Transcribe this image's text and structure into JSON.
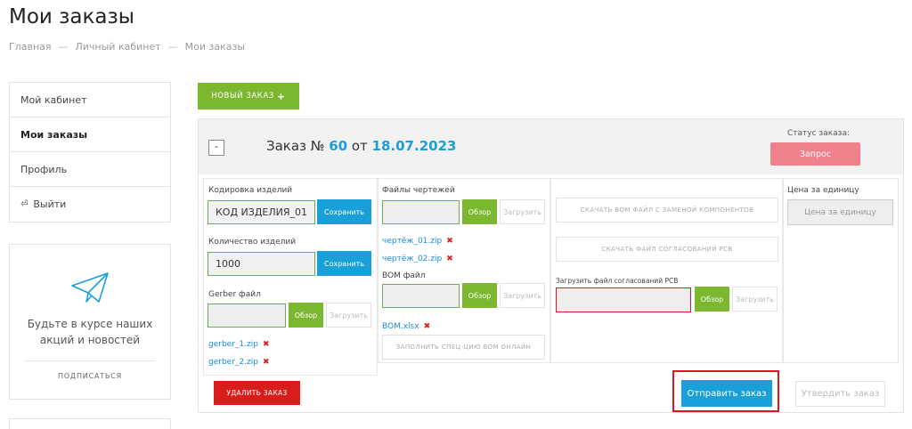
{
  "page": {
    "title": "Мои заказы",
    "breadcrumb": [
      "Главная",
      "Личный кабинет",
      "Мои заказы"
    ],
    "breadcrumb_sep": "—"
  },
  "sidebar": {
    "items": [
      {
        "label": "Мой кабинет"
      },
      {
        "label": "Мои заказы"
      },
      {
        "label": "Профиль"
      },
      {
        "label": "Выйти"
      }
    ],
    "promo_text_1": "Будьте в курсе наших",
    "promo_text_2": "акций и новостей",
    "subscribe": "ПОДПИСАТЬСЯ"
  },
  "new_order_label": "НОВЫЙ ЗАКАЗ",
  "order": {
    "title_prefix": "Заказ №",
    "number": "60",
    "from": "от",
    "date": "18.07.2023",
    "status_label": "Статус заказа:",
    "status": "Запрос",
    "collapse": "-",
    "coding_label": "Кодировка изделий",
    "coding_value": "КОД ИЗДЕЛИЯ_01",
    "save": "Сохранить",
    "qty_label": "Количество изделий",
    "qty_value": "1000",
    "gerber_label": "Gerber файл",
    "browse": "Обзор",
    "upload": "Загрузить",
    "gerber_files": [
      "gerber_1.zip",
      "gerber_2.zip"
    ],
    "drawings_label": "Файлы чертежей",
    "drawing_files": [
      "чертёж_01.zip",
      "чертёж_02.zip"
    ],
    "bom_label": "BOM файл",
    "bom_files": [
      "BOM.xlsx"
    ],
    "bom_online": "ЗАПОЛНИТЬ СПЕЦ-ЦИЮ BOM ОНЛАЙН",
    "download_bom": "СКАЧАТЬ BOM ФАЙЛ С ЗАМЕНОЙ КОМПОНЕНТОВ",
    "download_pcb": "СКАЧАТЬ ФАЙЛ СОГЛАСОВАНИЙ PCB",
    "upload_pcb_label": "Загрузить файл согласований PCB",
    "price_label": "Цена за единицу",
    "price_placeholder": "Цена за единицу",
    "delete": "УДАЛИТЬ ЗАКАЗ",
    "send": "Отправить заказ",
    "approve": "Утвердить заказ"
  },
  "colors": {
    "accent_blue": "#1aa0d8",
    "accent_green": "#7cb82f",
    "status_pink": "#ee818c",
    "danger_red": "#d91c1c"
  }
}
